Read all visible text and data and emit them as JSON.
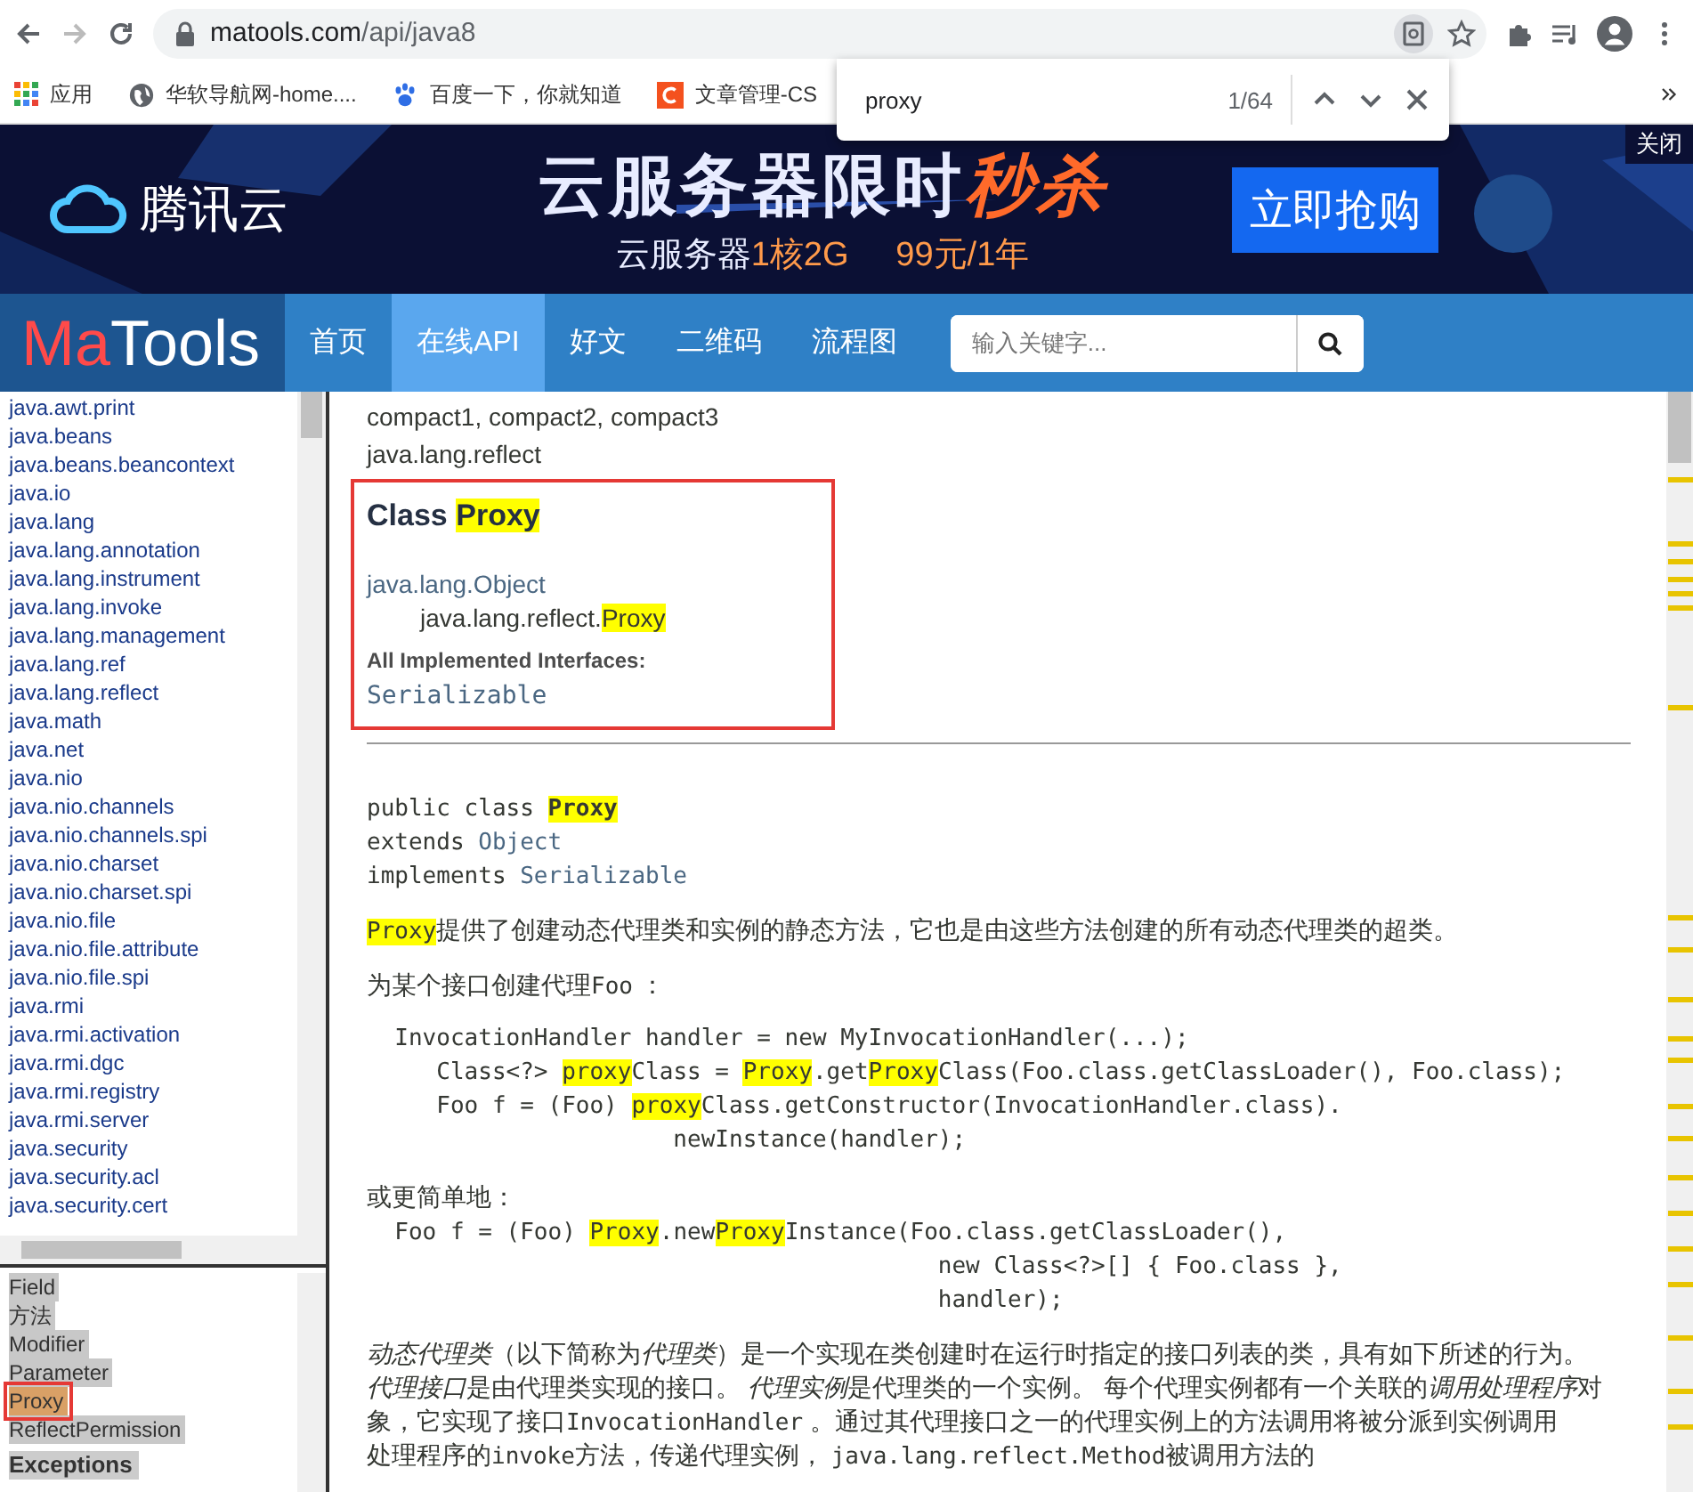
{
  "browser": {
    "url_host": "matools.com",
    "url_path": "/api/java8",
    "bookmarks": [
      {
        "kind": "apps",
        "label": "应用"
      },
      {
        "kind": "globe",
        "label": "华软导航网-home...."
      },
      {
        "kind": "paw",
        "label": "百度一下，你就知道"
      },
      {
        "kind": "letter",
        "label": "文章管理-CS"
      }
    ]
  },
  "find_bar": {
    "query": "proxy",
    "count": "1/64"
  },
  "banner": {
    "logo": "腾讯云",
    "headline": "云服务器限时",
    "headline_accent": "秒杀",
    "sub": "云服务器",
    "sub_accent_1": "1核2G",
    "sub_accent_2": "99元/1年",
    "cta": "立即抢购",
    "close": "关闭"
  },
  "nav": {
    "logo_red": "Ma",
    "logo_rest": "Tools",
    "items": [
      {
        "label": "首页",
        "selected": false
      },
      {
        "label": "在线API",
        "selected": true
      },
      {
        "label": "好文",
        "selected": false
      },
      {
        "label": "二维码",
        "selected": false
      },
      {
        "label": "流程图",
        "selected": false
      }
    ],
    "search": {
      "placeholder": "输入关键字..."
    }
  },
  "packages": [
    "java.awt.print",
    "java.beans",
    "java.beans.beancontext",
    "java.io",
    "java.lang",
    "java.lang.annotation",
    "java.lang.instrument",
    "java.lang.invoke",
    "java.lang.management",
    "java.lang.ref",
    "java.lang.reflect",
    "java.math",
    "java.net",
    "java.nio",
    "java.nio.channels",
    "java.nio.channels.spi",
    "java.nio.charset",
    "java.nio.charset.spi",
    "java.nio.file",
    "java.nio.file.attribute",
    "java.nio.file.spi",
    "java.rmi",
    "java.rmi.activation",
    "java.rmi.dgc",
    "java.rmi.registry",
    "java.rmi.server",
    "java.security",
    "java.security.acl",
    "java.security.cert"
  ],
  "classes": [
    {
      "label": "Field",
      "selected": false
    },
    {
      "label": "方法",
      "selected": false
    },
    {
      "label": "Modifier",
      "selected": false
    },
    {
      "label": "Parameter",
      "selected": false
    },
    {
      "label": "Proxy",
      "selected": true
    },
    {
      "label": "ReflectPermission",
      "selected": false
    }
  ],
  "classes_heading": "Exceptions",
  "content": {
    "profiles": "compact1, compact2, compact3",
    "package": "java.lang.reflect",
    "title": "Class",
    "title_match": "Proxy",
    "super": "java.lang.Object",
    "self_prefix": "java.lang.reflect.",
    "self_match": "Proxy",
    "interfaces_label": "All Implemented Interfaces:",
    "interfaces": "Serializable",
    "signature": [
      [
        {
          "kind": "code",
          "t": "public class "
        },
        {
          "kind": "code_match_bold",
          "t": "Proxy"
        }
      ],
      [
        {
          "kind": "code",
          "t": "extends "
        },
        {
          "kind": "code_link",
          "t": "Object"
        }
      ],
      [
        {
          "kind": "code",
          "t": "implements "
        },
        {
          "kind": "code_link",
          "t": "Serializable"
        }
      ]
    ],
    "blocks": [
      {
        "kind": "para",
        "lines": [
          [
            {
              "kind": "code_match",
              "t": "Proxy"
            },
            {
              "kind": "text",
              "t": "提供了创建动态代理类和实例的静态方法，它也是由这些方法创建的所有动态代理类的超类。"
            }
          ]
        ]
      },
      {
        "kind": "para",
        "lines": [
          [
            {
              "kind": "text",
              "t": "为某个接口创建代理"
            },
            {
              "kind": "code",
              "t": "Foo"
            },
            {
              "kind": "text",
              "t": " ："
            }
          ]
        ]
      },
      {
        "kind": "pre",
        "lines": [
          [
            {
              "kind": "code",
              "t": "  InvocationHandler handler = new MyInvocationHandler(...);"
            }
          ],
          [
            {
              "kind": "code",
              "t": "     Class<?> "
            },
            {
              "kind": "code_match",
              "t": "proxy"
            },
            {
              "kind": "code",
              "t": "Class = "
            },
            {
              "kind": "code_match",
              "t": "Proxy"
            },
            {
              "kind": "code",
              "t": ".get"
            },
            {
              "kind": "code_match",
              "t": "Proxy"
            },
            {
              "kind": "code",
              "t": "Class(Foo.class.getClassLoader(), Foo.class);"
            }
          ],
          [
            {
              "kind": "code",
              "t": "     Foo f = (Foo) "
            },
            {
              "kind": "code_match",
              "t": "proxy"
            },
            {
              "kind": "code",
              "t": "Class.getConstructor(InvocationHandler.class)."
            }
          ],
          [
            {
              "kind": "code",
              "t": "                      newInstance(handler);"
            }
          ]
        ]
      },
      {
        "kind": "para_tight",
        "lines": [
          [
            {
              "kind": "text",
              "t": "或更简单地："
            }
          ]
        ]
      },
      {
        "kind": "pre_tight",
        "lines": [
          [
            {
              "kind": "code",
              "t": "  Foo f = (Foo) "
            },
            {
              "kind": "code_match",
              "t": "Proxy"
            },
            {
              "kind": "code",
              "t": ".new"
            },
            {
              "kind": "code_match",
              "t": "Proxy"
            },
            {
              "kind": "code",
              "t": "Instance(Foo.class.getClassLoader(),"
            }
          ],
          [
            {
              "kind": "code",
              "t": "                                         new Class<?>[] { Foo.class },"
            }
          ],
          [
            {
              "kind": "code",
              "t": "                                         handler);"
            }
          ]
        ]
      },
      {
        "kind": "para",
        "lines": [
          [
            {
              "kind": "em",
              "t": "动态代理类"
            },
            {
              "kind": "text",
              "t": "（以下简称为"
            },
            {
              "kind": "em",
              "t": "代理类"
            },
            {
              "kind": "text",
              "t": "）是一个实现在类创建时在运行时指定的接口列表的类，具有如下所述的行为。"
            }
          ],
          [
            {
              "kind": "em",
              "t": "代理接口"
            },
            {
              "kind": "text",
              "t": "是由代理类实现的接口。 "
            },
            {
              "kind": "em",
              "t": "代理实例"
            },
            {
              "kind": "text",
              "t": "是代理类的一个实例。 每个代理实例都有一个关联的"
            },
            {
              "kind": "em",
              "t": "调用处理程序"
            },
            {
              "kind": "text",
              "t": "对"
            }
          ],
          [
            {
              "kind": "text",
              "t": "象，它实现了接口"
            },
            {
              "kind": "code",
              "t": "InvocationHandler"
            },
            {
              "kind": "text",
              "t": " 。通过其代理接口之一的代理实例上的方法调用将被分派到实例调用"
            }
          ],
          [
            {
              "kind": "text",
              "t": "处理程序的"
            },
            {
              "kind": "code",
              "t": "invoke"
            },
            {
              "kind": "text",
              "t": "方法，传递代理实例， "
            },
            {
              "kind": "code",
              "t": "java.lang.reflect.Method"
            },
            {
              "kind": "text",
              "t": "被调用方法的"
            }
          ]
        ]
      }
    ]
  }
}
